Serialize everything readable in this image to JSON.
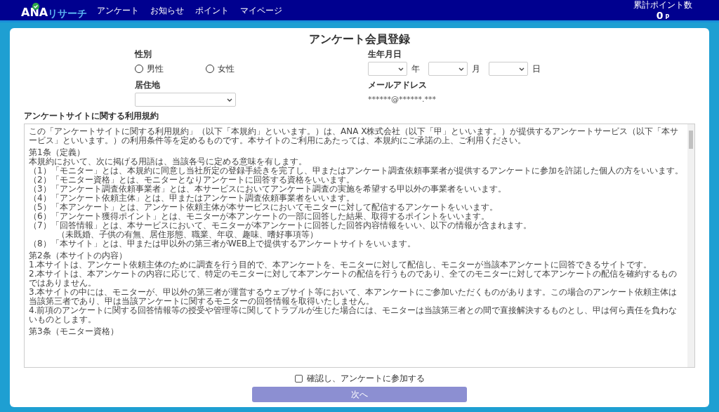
{
  "header": {
    "logo_primary": "ANA",
    "logo_secondary": "リサーチ",
    "nav": [
      {
        "label": "アンケート"
      },
      {
        "label": "お知らせ"
      },
      {
        "label": "ポイント"
      },
      {
        "label": "マイページ"
      }
    ],
    "points": {
      "label": "累計ポイント数",
      "value": "0",
      "unit": "P"
    }
  },
  "form": {
    "title": "アンケート会員登録",
    "fields": [
      {
        "kind": "radio",
        "label": "性別",
        "options": [
          {
            "label": "男性",
            "selected": false
          },
          {
            "label": "女性",
            "selected": false
          }
        ]
      },
      {
        "kind": "date",
        "label": "生年月日",
        "parts": [
          {
            "unit": "年"
          },
          {
            "unit": "月"
          },
          {
            "unit": "日"
          }
        ]
      },
      {
        "kind": "select",
        "label": "居住地"
      },
      {
        "kind": "text",
        "label": "メールアドレス",
        "value": "******@******.***"
      }
    ]
  },
  "terms": {
    "title": "アンケートサイトに関する利用規約",
    "intro": "この「アンケートサイトに関する利用規約」（以下「本規約」といいます。）は、ANA X株式会社（以下「甲」といいます。）が提供するアンケートサービス（以下「本サービス」といいます。）の利用条件等を定めるものです。本サイトのご利用にあたっては、本規約にご承諾の上、ご利用ください。",
    "sections": [
      {
        "heading": "第1条（定義）",
        "items": [
          {
            "text": "本規約において、次に掲げる用語は、当該各号に定める意味を有します。",
            "indented": false
          },
          {
            "text": "（1）「モニター」とは、本規約に同意し当社所定の登録手続きを完了し、甲またはアンケート調査依頼事業者が提供するアンケートに参加を許諾した個人の方をいいます。",
            "indented": false
          },
          {
            "text": "（2）「モニター資格」とは、モニターとなりアンケートに回答する資格をいいます。",
            "indented": false
          },
          {
            "text": "（3）「アンケート調査依頼事業者」とは、本サービスにおいてアンケート調査の実施を希望する甲以外の事業者をいいます。",
            "indented": false
          },
          {
            "text": "（4）「アンケート依頼主体」とは、甲またはアンケート調査依頼事業者をいいます。",
            "indented": false
          },
          {
            "text": "（5）「本アンケート」とは、アンケート依頼主体が本サービスにおいてモニターに対して配信するアンケートをいいます。",
            "indented": false
          },
          {
            "text": "（6）「アンケート獲得ポイント」とは、モニターが本アンケートの一部に回答した結果、取得するポイントをいいます。",
            "indented": false
          },
          {
            "text": "（7）「回答情報」とは、本サービスにおいて、モニターが本アンケートに回答した回答内容情報をいい、以下の情報が含まれます。",
            "indented": false
          },
          {
            "text": "（未既婚、子供の有無、居住形態、職業、年収、趣味、嗜好事項等）",
            "indented": true
          },
          {
            "text": "（8）「本サイト」とは、甲または甲以外の第三者がWEB上で提供するアンケートサイトをいいます。",
            "indented": false
          }
        ]
      },
      {
        "heading": "第2条（本サイトの内容）",
        "items": [
          {
            "text": "1.本サイトは、アンケート依頼主体のために調査を行う目的で、本アンケートを、モニターに対して配信し、モニターが当該本アンケートに回答できるサイトです。",
            "indented": false
          },
          {
            "text": "2.本サイトは、本アンケートの内容に応じて、特定のモニターに対して本アンケートの配信を行うものであり、全てのモニターに対して本アンケートの配信を確約するものではありません。",
            "indented": false
          },
          {
            "text": "3.本サイトの中には、モニターが、甲以外の第三者が運営するウェブサイト等において、本アンケートにご参加いただくものがあります。この場合のアンケート依頼主体は当該第三者であり、甲は当該アンケートに関するモニターの回答情報を取得いたしません。",
            "indented": false
          },
          {
            "text": "4.前項のアンケートに関する回答情報等の授受や管理等に関してトラブルが生じた場合には、モニターは当該第三者との間で直接解決するものとし、甲は何ら責任を負わないものとします。",
            "indented": false
          }
        ]
      },
      {
        "heading": "第3条（モニター資格）"
      }
    ]
  },
  "consent": {
    "label": "確認し、アンケートに参加する",
    "checked": false
  },
  "submit": {
    "label": "次へ",
    "disabled": true
  }
}
